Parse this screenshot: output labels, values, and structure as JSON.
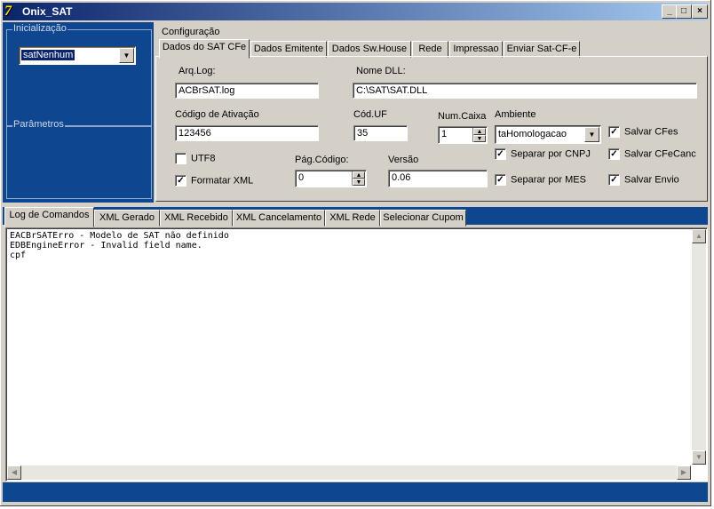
{
  "window": {
    "title": "Onix_SAT",
    "icon": "app-icon"
  },
  "title_buttons": {
    "minimize": "_",
    "maximize": "□",
    "close": "×"
  },
  "inicializacao": {
    "label": "Inicialização",
    "model_select": "satNenhum"
  },
  "parametros": {
    "label": "Parâmetros"
  },
  "config": {
    "label": "Configuração",
    "tabs": [
      "Dados do SAT CFe",
      "Dados Emitente",
      "Dados Sw.House",
      "Rede",
      "Impressao",
      "Enviar Sat-CF-e"
    ],
    "active_tab": 0,
    "fields": {
      "arq_log_label": "Arq.Log:",
      "arq_log_value": "ACBrSAT.log",
      "nome_dll_label": "Nome DLL:",
      "nome_dll_value": "C:\\SAT\\SAT.DLL",
      "codigo_ativacao_label": "Código de Ativação",
      "codigo_ativacao_value": "123456",
      "cod_uf_label": "Cód.UF",
      "cod_uf_value": "35",
      "num_caixa_label": "Num.Caixa",
      "num_caixa_value": "1",
      "ambiente_label": "Ambiente",
      "ambiente_value": "taHomologacao",
      "pag_codigo_label": "Pág.Código:",
      "pag_codigo_value": "0",
      "versao_label": "Versão",
      "versao_value": "0.06"
    },
    "checks": {
      "utf8": {
        "label": "UTF8",
        "checked": false
      },
      "formatar_xml": {
        "label": "Formatar XML",
        "checked": true
      },
      "salvar_cfes": {
        "label": "Salvar CFes",
        "checked": true
      },
      "separar_cnpj": {
        "label": "Separar por CNPJ",
        "checked": true
      },
      "salvar_cfecanc": {
        "label": "Salvar CFeCanc",
        "checked": true
      },
      "separar_mes": {
        "label": "Separar por MES",
        "checked": true
      },
      "salvar_envio": {
        "label": "Salvar Envio",
        "checked": true
      }
    }
  },
  "log_tabs": [
    "Log de Comandos",
    "XML Gerado",
    "XML Recebido",
    "XML Cancelamento",
    "XML Rede",
    "Selecionar Cupom"
  ],
  "active_log_tab": 0,
  "log_lines": [
    "EACBrSATErro - Modelo de SAT não definido",
    "EDBEngineError - Invalid field name.",
    "cpf"
  ],
  "colors": {
    "panel_blue": "#0e4790",
    "face": "#d4d0c8",
    "title_start": "#0a246a",
    "title_end": "#a6caf0"
  }
}
